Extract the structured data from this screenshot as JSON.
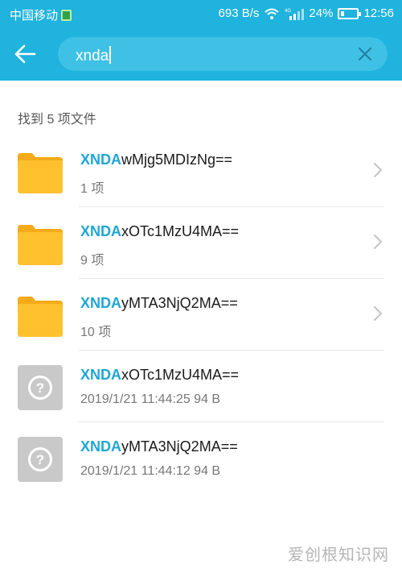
{
  "status_bar": {
    "carrier": "中国移动",
    "speed": "693 B/s",
    "network_type": "4G",
    "battery": "24%",
    "battery_level": 0.24,
    "time": "12:56"
  },
  "search": {
    "query": "xnda"
  },
  "results": {
    "count_text": "找到 5 项文件",
    "items": [
      {
        "kind": "folder",
        "highlight": "XNDA",
        "rest": "wMjg5MDIzNg==",
        "meta": "1 项"
      },
      {
        "kind": "folder",
        "highlight": "XNDA",
        "rest": "xOTc1MzU4MA==",
        "meta": "9 项"
      },
      {
        "kind": "folder",
        "highlight": "XNDA",
        "rest": "yMTA3NjQ2MA==",
        "meta": "10 项"
      },
      {
        "kind": "unknown-file",
        "highlight": "XNDA",
        "rest": "xOTc1MzU4MA==",
        "meta": "2019/1/21 11:44:25 94 B"
      },
      {
        "kind": "unknown-file",
        "highlight": "XNDA",
        "rest": "yMTA3NjQ2MA==",
        "meta": "2019/1/21 11:44:12 94 B"
      }
    ]
  },
  "watermark": "爱创根知识网",
  "colors": {
    "accent": "#1fb3dd",
    "highlight": "#1fa6d6",
    "folder": "#ffc12e"
  },
  "icons": [
    "sim-icon",
    "wifi-icon",
    "signal-icon",
    "battery-icon",
    "back-arrow-icon",
    "clear-icon",
    "folder-icon",
    "unknown-file-icon",
    "chevron-right-icon"
  ]
}
